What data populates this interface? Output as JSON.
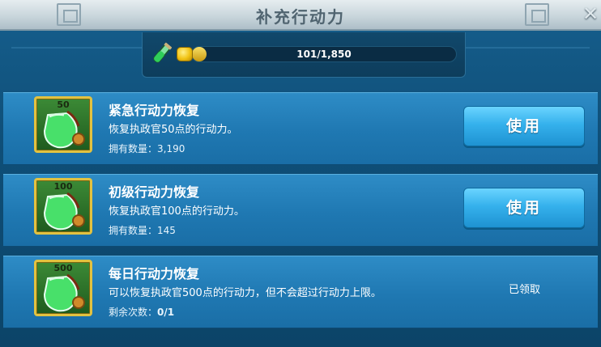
{
  "window": {
    "title": "补充行动力",
    "close_label": "✕"
  },
  "energy": {
    "current_text": "101/1,850",
    "fill_fraction": 0.055
  },
  "items": [
    {
      "count": "50",
      "title": "紧急行动力恢复",
      "description": "恢复执政官50点的行动力。",
      "owned_label": "拥有数量：",
      "owned_value": "3,190",
      "button_label": "使用"
    },
    {
      "count": "100",
      "title": "初级行动力恢复",
      "description": "恢复执政官100点的行动力。",
      "owned_label": "拥有数量：",
      "owned_value": "145",
      "button_label": "使用"
    },
    {
      "count": "500",
      "title": "每日行动力恢复",
      "description": "可以恢复执政官500点的行动力，但不会超过行动力上限。",
      "owned_label": "剩余次数：",
      "owned_value": "0/1",
      "status_label": "已领取"
    }
  ],
  "colors": {
    "button": "#35b1ec",
    "row": "#1f78b2",
    "frame_gold": "#e2c240"
  }
}
